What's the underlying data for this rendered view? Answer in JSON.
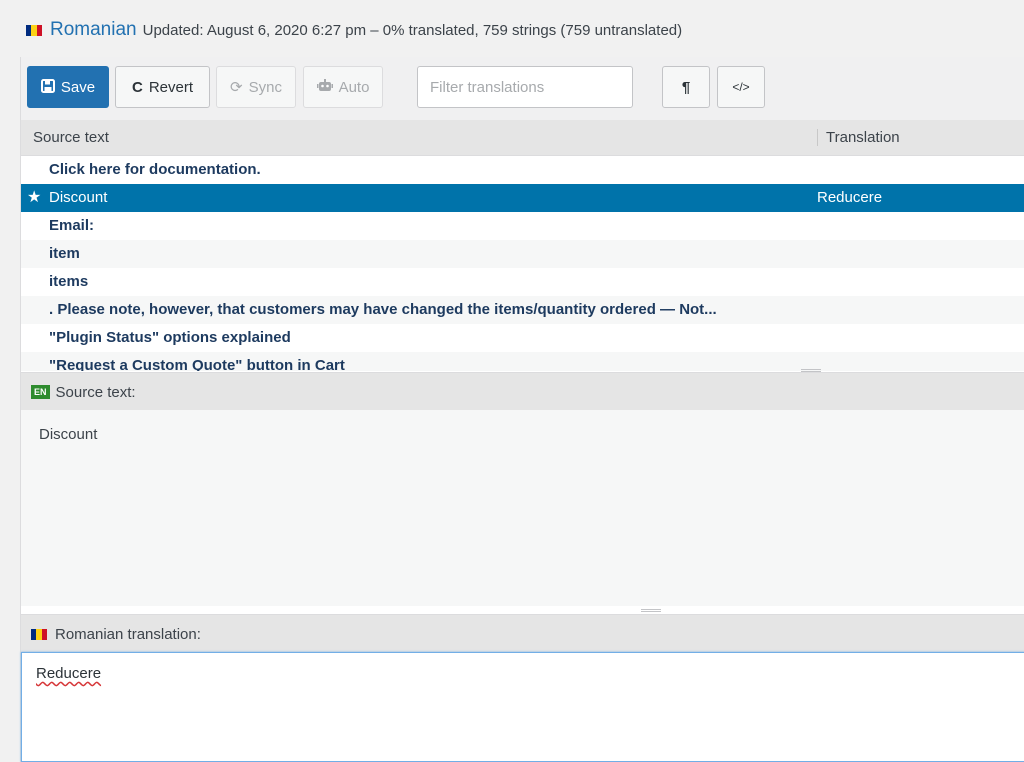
{
  "header": {
    "language": "Romanian",
    "meta": "Updated: August 6, 2020 6:27 pm – 0% translated, 759 strings (759 untranslated)",
    "flag_colors": [
      "#002b7f",
      "#fcd116",
      "#ce1126"
    ]
  },
  "toolbar": {
    "save_label": "Save",
    "save_icon": "floppy-disk-icon",
    "revert_label": "Revert",
    "revert_icon": "undo-icon",
    "sync_label": "Sync",
    "sync_icon": "sync-icon",
    "auto_label": "Auto",
    "auto_icon": "robot-icon",
    "filter_placeholder": "Filter translations",
    "pilcrow_label": "¶",
    "code_label": "</>"
  },
  "list": {
    "col_source": "Source text",
    "col_translation": "Translation",
    "rows": [
      {
        "source": "Click here for documentation.",
        "translation": ""
      },
      {
        "source": "Discount",
        "translation": "Reducere",
        "selected": true
      },
      {
        "source": "Email:",
        "translation": ""
      },
      {
        "source": "item",
        "translation": ""
      },
      {
        "source": "items",
        "translation": ""
      },
      {
        "source": ". Please note, however, that customers may have changed the items/quantity ordered — Not...",
        "translation": ""
      },
      {
        "source": "\"Plugin Status\" options explained",
        "translation": ""
      },
      {
        "source": "\"Request a Custom Quote\" button in Cart",
        "translation": ""
      }
    ]
  },
  "source_pane": {
    "badge": "EN",
    "label": "Source text:",
    "text": "Discount"
  },
  "translation_pane": {
    "label": "Romanian translation:",
    "value": "Reducere"
  },
  "colors": {
    "accent": "#2271b1",
    "selected_row": "#0073aa"
  }
}
